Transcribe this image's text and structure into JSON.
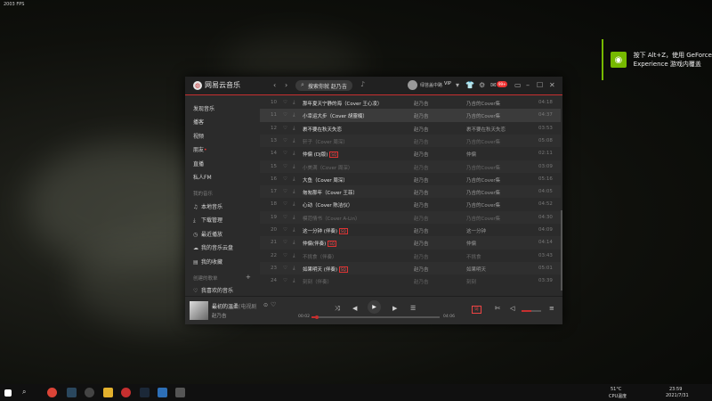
{
  "fps": "2003 FPS",
  "notification": {
    "line1": "按下 Alt+Z，使用 GeForce",
    "line2": "Experience 游戏内覆盖"
  },
  "app": {
    "title": "网易云音乐",
    "search_value": "搜索你就 赵乃吉",
    "username": "绿苔盖中路",
    "vip": "VIP",
    "msg_badge": "99+"
  },
  "sidebar": {
    "items": [
      "发现音乐",
      "播客",
      "视频",
      "朋友",
      "直播",
      "私人FM"
    ],
    "my_music_header": "我的音乐",
    "my_music": [
      "本地音乐",
      "下载管理",
      "最近播放",
      "我的音乐云盘",
      "我的收藏"
    ],
    "created_header": "创建的歌单",
    "favorite": "我喜欢的音乐"
  },
  "songs": [
    {
      "no": "10",
      "title": "那年夏天宁静的海（Cover 王心凌）",
      "artist": "赵乃吉",
      "album": "乃吉的Cover集",
      "dur": "04:18",
      "dim": false,
      "tag": ""
    },
    {
      "no": "11",
      "title": "小幸运大步（Cover 胡靈楠）",
      "artist": "赵乃吉",
      "album": "乃吉的Cover集",
      "dur": "04:37",
      "dim": false,
      "tag": ""
    },
    {
      "no": "12",
      "title": "裹不要在秋天失恋",
      "artist": "赵乃吉",
      "album": "裹不要在秋天失恋",
      "dur": "03:53",
      "dim": false,
      "tag": ""
    },
    {
      "no": "13",
      "title": "轩子（Cover 周深）",
      "artist": "赵乃吉",
      "album": "乃吉的Cover集",
      "dur": "05:08",
      "dim": true,
      "tag": ""
    },
    {
      "no": "14",
      "title": "仲偏 (DJ版)",
      "artist": "赵乃吉",
      "album": "仲偏",
      "dur": "02:11",
      "dim": false,
      "tag": "SQ"
    },
    {
      "no": "15",
      "title": "小美满（Cover 周深）",
      "artist": "赵乃吉",
      "album": "乃吉的Cover集",
      "dur": "03:09",
      "dim": true,
      "tag": ""
    },
    {
      "no": "16",
      "title": "大鱼（Cover 周深）",
      "artist": "赵乃吉",
      "album": "乃吉的Cover集",
      "dur": "05:16",
      "dim": false,
      "tag": ""
    },
    {
      "no": "17",
      "title": "匆匆那年（Cover 王菲）",
      "artist": "赵乃吉",
      "album": "乃吉的Cover集",
      "dur": "04:05",
      "dim": false,
      "tag": ""
    },
    {
      "no": "18",
      "title": "心动（Cover 陈洁仪）",
      "artist": "赵乃吉",
      "album": "乃吉的Cover集",
      "dur": "04:52",
      "dim": false,
      "tag": ""
    },
    {
      "no": "19",
      "title": "模范情书（Cover A-Lin）",
      "artist": "赵乃吉",
      "album": "乃吉的Cover集",
      "dur": "04:30",
      "dim": true,
      "tag": ""
    },
    {
      "no": "20",
      "title": "这一分钟 (伴奏)",
      "artist": "赵乃吉",
      "album": "这一分钟",
      "dur": "04:09",
      "dim": false,
      "tag": "SQ"
    },
    {
      "no": "21",
      "title": "仲偏(伴奏)",
      "artist": "赵乃吉",
      "album": "仲偏",
      "dur": "04:14",
      "dim": false,
      "tag": "SQ"
    },
    {
      "no": "22",
      "title": "不挑食（伴奏）",
      "artist": "赵乃吉",
      "album": "不挑食",
      "dur": "03:43",
      "dim": true,
      "tag": ""
    },
    {
      "no": "23",
      "title": "如果明天 (伴奏)",
      "artist": "赵乃吉",
      "album": "如果明天",
      "dur": "05:01",
      "dim": false,
      "tag": "SQ"
    },
    {
      "no": "24",
      "title": "刻刻（伴奏）",
      "artist": "赵乃吉",
      "album": "刻刻",
      "dur": "03:39",
      "dim": true,
      "tag": ""
    }
  ],
  "player": {
    "title": "最初的温柔",
    "subtitle": "(电视剧",
    "artist": "赵乃吉",
    "elapsed": "00:02",
    "total": "04:06",
    "progress": 0.04,
    "lyric_btn": "词",
    "volume": 0.5
  },
  "taskbar": {
    "temp": "51°C",
    "cpu": "CPU温度",
    "time": "23:59",
    "date": "2021/7/31"
  },
  "colors": {
    "accent": "#c62f2f",
    "nvidia": "#76b900"
  }
}
